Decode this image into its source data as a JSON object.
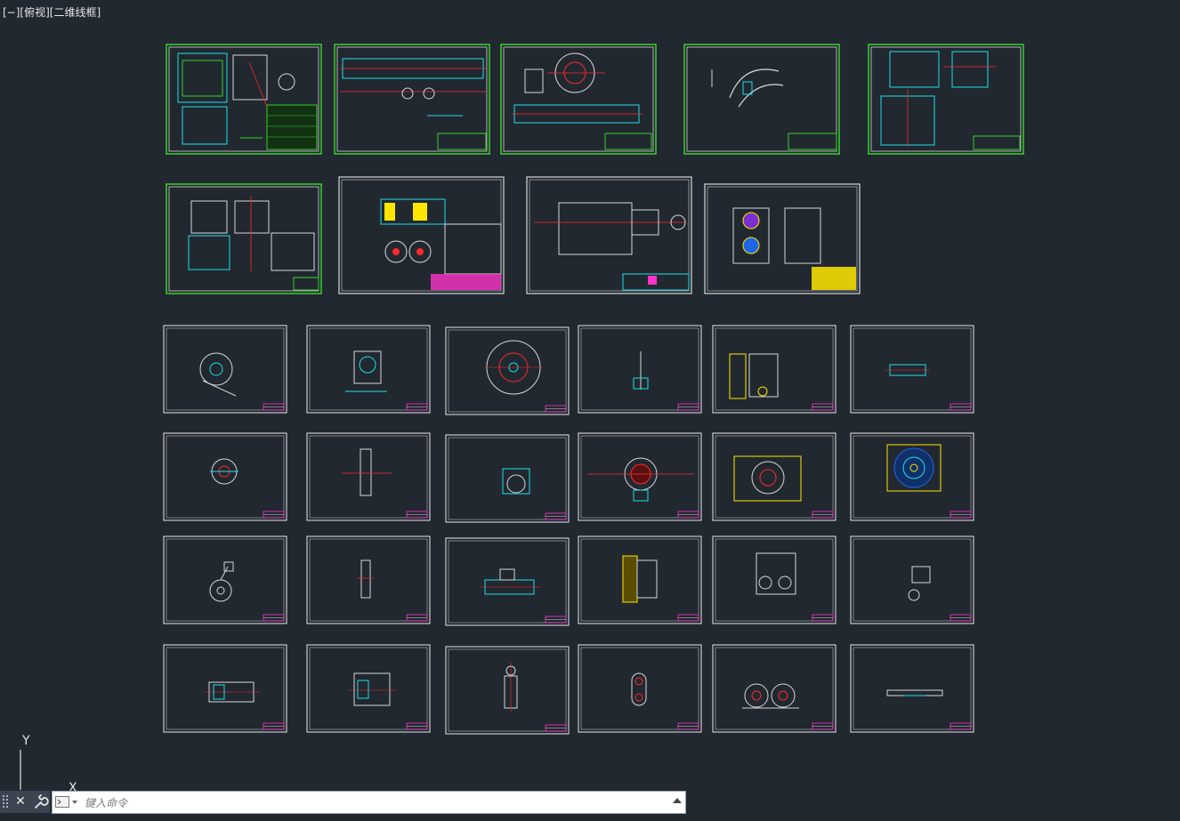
{
  "viewport": {
    "label": "[−][俯视][二维线框]"
  },
  "ucs_icon": {
    "y_label": "Y",
    "x_label": "X"
  },
  "command_line": {
    "placeholder": "键入命令",
    "close_icon": "close-icon",
    "customize_icon": "wrench-icon",
    "prompt_icon": "command-prompt-icon",
    "history_icon": "caret-up-icon"
  },
  "sheets": {
    "assembly_sheets": 9,
    "part_sheets": 24
  },
  "colors": {
    "background": "#212830",
    "frame_white": "#d8d8d8",
    "frame_green": "#39d12b",
    "cyan": "#1ee0e6",
    "red": "#ff2a2a",
    "yellow": "#ffe600",
    "magenta": "#ff33cc",
    "green": "#39d12b"
  }
}
